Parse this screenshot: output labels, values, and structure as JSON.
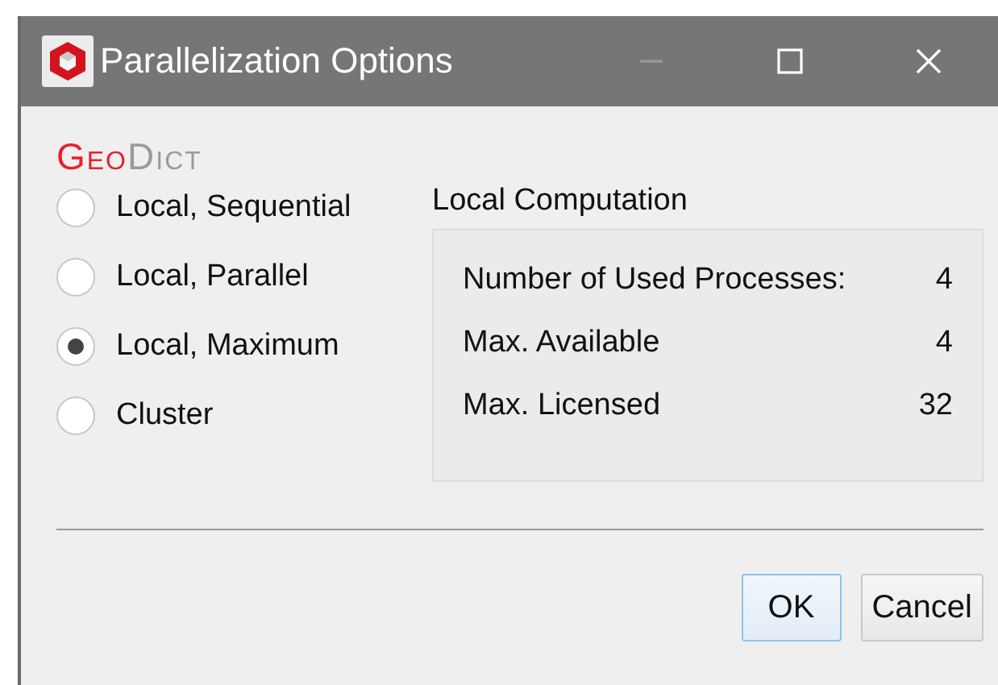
{
  "window": {
    "title": "Parallelization Options",
    "controls": [
      {
        "kind": "minimize",
        "disabled": true
      },
      {
        "kind": "maximize",
        "disabled": false
      },
      {
        "kind": "close",
        "disabled": false
      }
    ]
  },
  "logo": [
    {
      "text": "Geo",
      "color": "#e8202a"
    },
    {
      "text": "Dict",
      "color": "#9a9a9a"
    }
  ],
  "modes": [
    {
      "label": "Local, Sequential",
      "selected": false
    },
    {
      "label": "Local, Parallel",
      "selected": false
    },
    {
      "label": "Local, Maximum",
      "selected": true
    },
    {
      "label": "Cluster",
      "selected": false
    }
  ],
  "group": {
    "title": "Local Computation",
    "rows": [
      {
        "label": "Number of Used Processes:",
        "value": "4"
      },
      {
        "label": "Max. Available",
        "value": "4"
      },
      {
        "label": "Max. Licensed",
        "value": "32"
      }
    ]
  },
  "buttons": [
    {
      "label": "OK",
      "default": true
    },
    {
      "label": "Cancel",
      "default": false
    }
  ]
}
